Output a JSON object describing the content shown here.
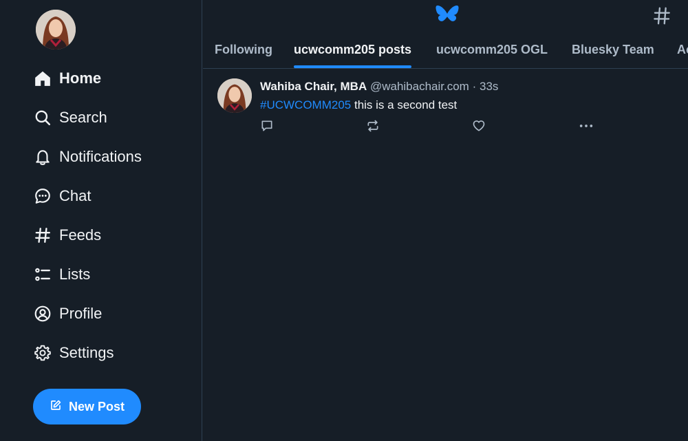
{
  "sidebar": {
    "avatar_icon": "user-avatar",
    "items": [
      {
        "label": "Home",
        "icon": "home-icon",
        "active": true
      },
      {
        "label": "Search",
        "icon": "search-icon"
      },
      {
        "label": "Notifications",
        "icon": "bell-icon"
      },
      {
        "label": "Chat",
        "icon": "chat-icon"
      },
      {
        "label": "Feeds",
        "icon": "hash-icon"
      },
      {
        "label": "Lists",
        "icon": "list-icon"
      },
      {
        "label": "Profile",
        "icon": "profile-icon"
      },
      {
        "label": "Settings",
        "icon": "gear-icon"
      }
    ],
    "new_post_label": "New Post"
  },
  "header": {
    "logo_icon": "butterfly-logo",
    "tabs": [
      {
        "label": "Following"
      },
      {
        "label": "ucwcomm205 posts",
        "active": true
      },
      {
        "label": "ucwcomm205 OGL"
      },
      {
        "label": "Bluesky Team"
      },
      {
        "label": "Ac"
      }
    ]
  },
  "post": {
    "author_name": "Wahiba Chair, MBA",
    "handle": "@wahibachair.com",
    "separator": "·",
    "time": "33s",
    "hashtag": "#UCWCOMM205",
    "text": " this is a second test"
  },
  "colors": {
    "background": "#161e27",
    "accent": "#208bfe",
    "muted": "#aebbc9",
    "border": "#2e4052"
  }
}
